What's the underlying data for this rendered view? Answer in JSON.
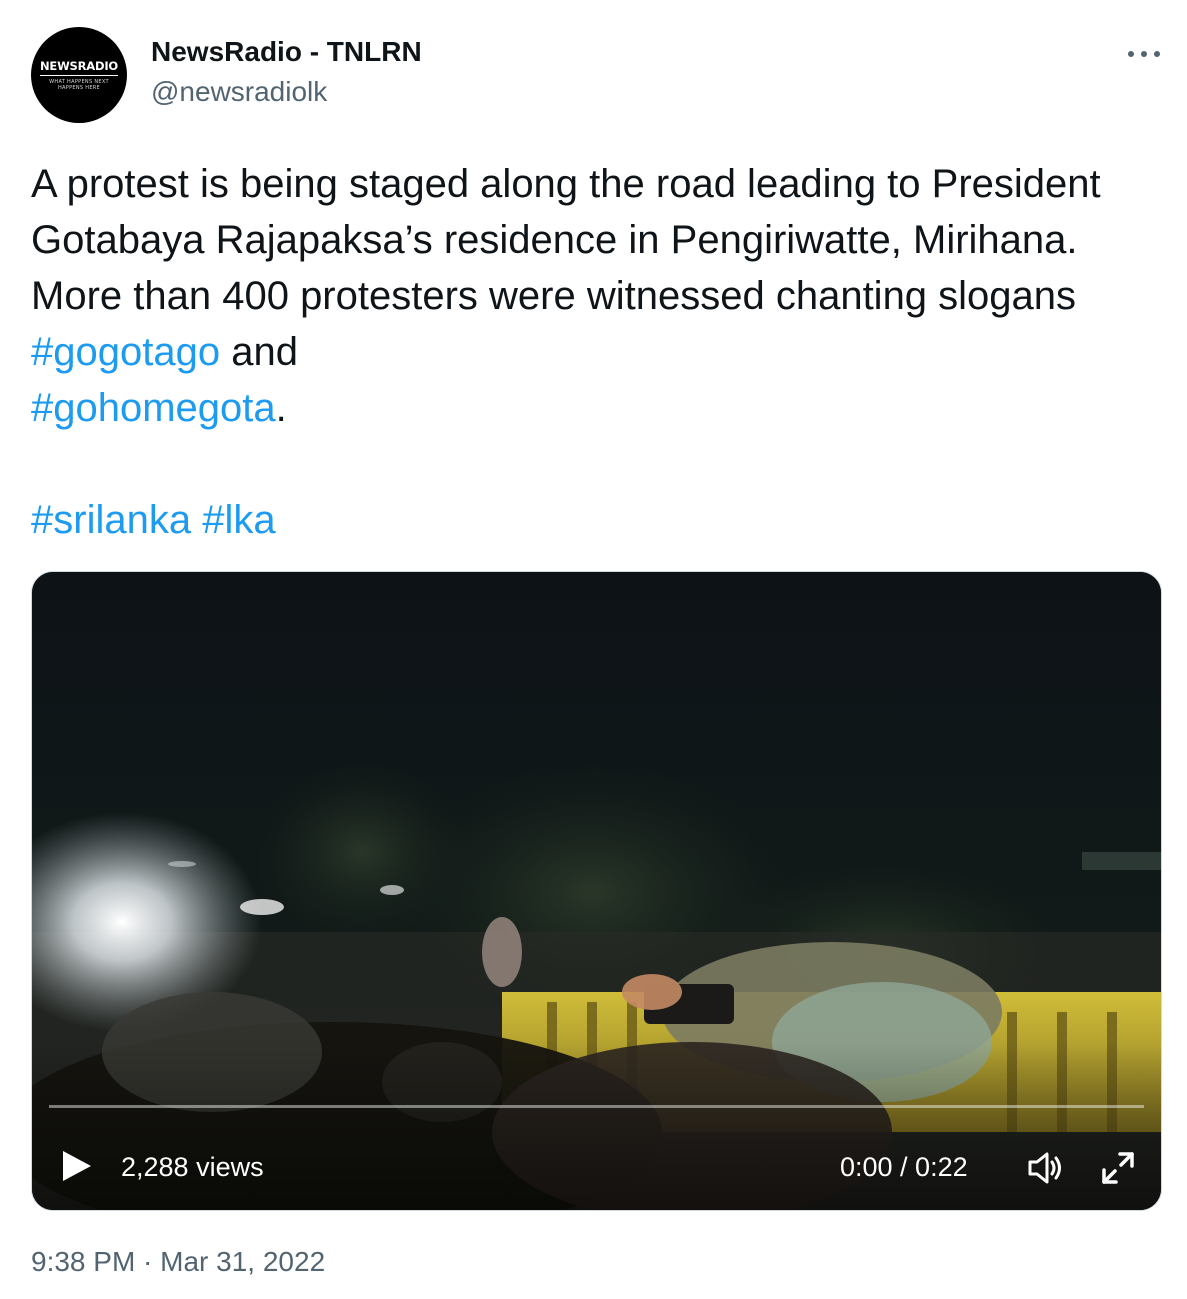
{
  "author": {
    "avatar_logo": "NEWSRADIO",
    "avatar_tagline": "WHAT HAPPENS NEXT HAPPENS HERE",
    "display_name": "NewsRadio - TNLRN",
    "handle": "@newsradiolk"
  },
  "tweet": {
    "text_part1": "A protest is being staged along the road leading to President Gotabaya Rajapaksa’s residence in Pengiriwatte, Mirihana. More than 400 protesters were witnessed chanting slogans ",
    "hashtag1": "#gogotago",
    "text_part2": " and ",
    "hashtag2": "#gohomegota",
    "text_part3": ".",
    "hashtag3": "#srilanka",
    "hashtag4": "#lka",
    "timestamp": "9:38 PM · Mar 31, 2022"
  },
  "video": {
    "views": "2,288 views",
    "time_readout": "0:00 / 0:22",
    "progress": 0.0
  },
  "icons": {
    "more": "more-horizontal-icon",
    "play": "play-icon",
    "volume": "volume-icon",
    "fullscreen": "fullscreen-icon"
  },
  "colors": {
    "link": "#1d9bf0",
    "secondary_text": "#536471",
    "primary_text": "#0f1419"
  }
}
